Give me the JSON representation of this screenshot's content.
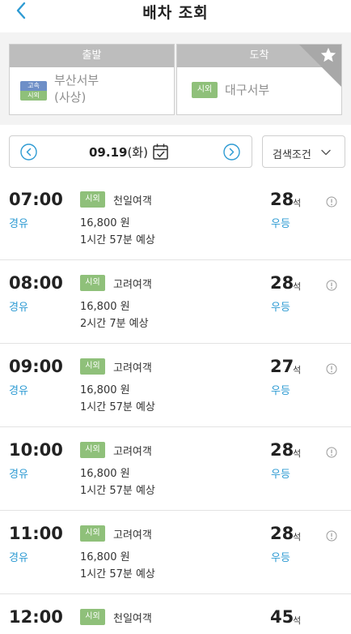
{
  "header": {
    "title": "배차 조회",
    "back_icon": "chevron-left-icon"
  },
  "route": {
    "departure": {
      "label": "출발",
      "type_top": "고속",
      "type_bottom": "시외",
      "name_line1": "부산서부",
      "name_line2": "(사상)"
    },
    "arrival": {
      "label": "도착",
      "badge": "시외",
      "name": "대구서부",
      "favorite_icon": "star-icon"
    }
  },
  "date_bar": {
    "date": "09.19",
    "weekday": "(화)",
    "prev_icon": "circle-chevron-left-icon",
    "next_icon": "circle-chevron-right-icon",
    "calendar_icon": "calendar-icon"
  },
  "filter": {
    "label": "검색조건",
    "icon": "chevron-down-icon"
  },
  "schedules": [
    {
      "time": "07:00",
      "route_type": "경유",
      "badge": "시외",
      "company": "천일여객",
      "fare": "16,800 원",
      "duration": "1시간 57분 예상",
      "seats": "28",
      "seat_unit": "석",
      "grade": "우등"
    },
    {
      "time": "08:00",
      "route_type": "경유",
      "badge": "시외",
      "company": "고려여객",
      "fare": "16,800 원",
      "duration": "2시간 7분 예상",
      "seats": "28",
      "seat_unit": "석",
      "grade": "우등"
    },
    {
      "time": "09:00",
      "route_type": "경유",
      "badge": "시외",
      "company": "고려여객",
      "fare": "16,800 원",
      "duration": "1시간 57분 예상",
      "seats": "27",
      "seat_unit": "석",
      "grade": "우등"
    },
    {
      "time": "10:00",
      "route_type": "경유",
      "badge": "시외",
      "company": "고려여객",
      "fare": "16,800 원",
      "duration": "1시간 57분 예상",
      "seats": "28",
      "seat_unit": "석",
      "grade": "우등"
    },
    {
      "time": "11:00",
      "route_type": "경유",
      "badge": "시외",
      "company": "고려여객",
      "fare": "16,800 원",
      "duration": "1시간 57분 예상",
      "seats": "28",
      "seat_unit": "석",
      "grade": "우등"
    },
    {
      "time": "12:00",
      "route_type": "",
      "badge": "시외",
      "company": "천일여객",
      "fare": "",
      "duration": "",
      "seats": "45",
      "seat_unit": "석",
      "grade": ""
    }
  ],
  "colors": {
    "accent_blue": "#2e9bd3",
    "badge_green": "#8fc07a",
    "express_blue": "#6e8fc7",
    "header_gray": "#bdbdbd"
  }
}
